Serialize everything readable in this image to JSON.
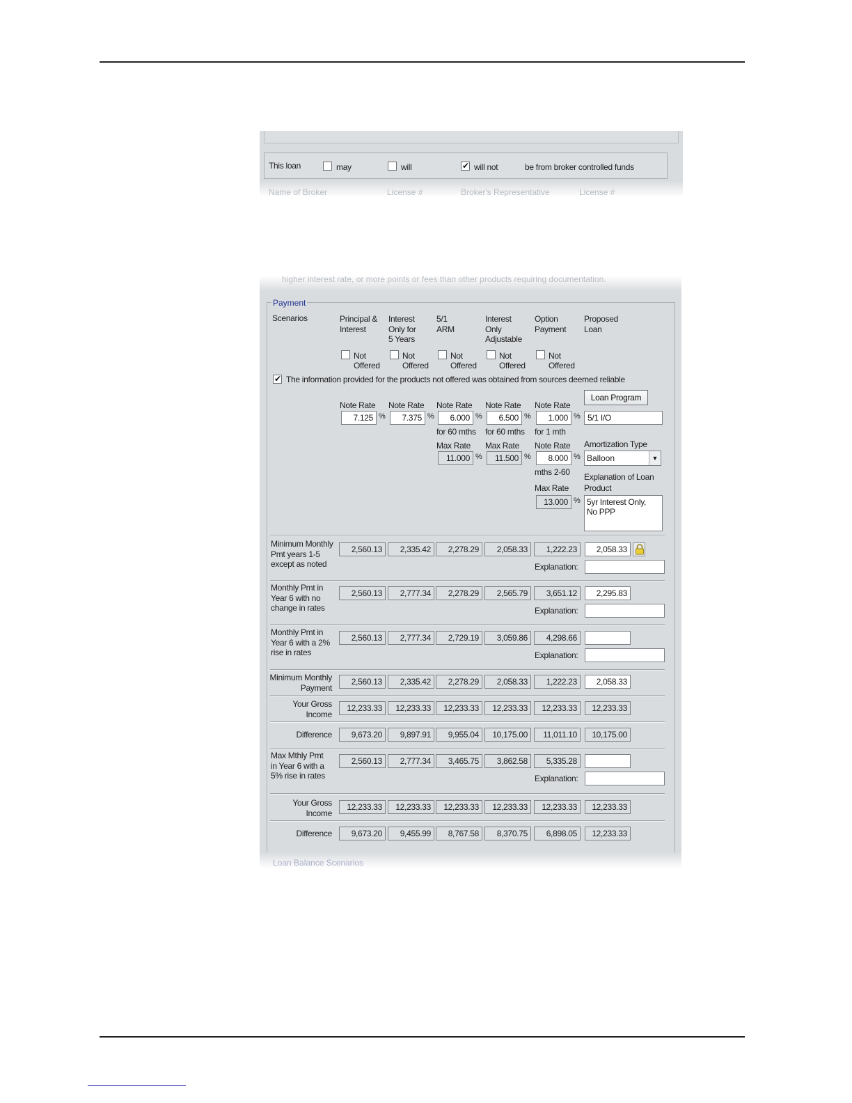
{
  "broker_funds": {
    "prefix": "This loan",
    "options": [
      {
        "label": "may",
        "checked": false
      },
      {
        "label": "will",
        "checked": false
      },
      {
        "label": "will not",
        "checked": true
      }
    ],
    "suffix": "be from broker controlled funds",
    "next_row_labels": [
      "Name of Broker",
      "License #",
      "Broker's Representative",
      "License #"
    ]
  },
  "cut_text": "higher interest rate, or more points or fees than other products requiring documentation.",
  "payment": {
    "group_title": "Payment",
    "scenarios_label": "Scenarios",
    "columns": [
      {
        "line1": "Principal &",
        "line2": "Interest",
        "line3": "",
        "not_offered": [
          "Not",
          "Offered"
        ]
      },
      {
        "line1": "Interest",
        "line2": "Only for",
        "line3": "5 Years",
        "not_offered": [
          "Not",
          "Offered"
        ]
      },
      {
        "line1": "5/1",
        "line2": "ARM",
        "line3": "",
        "not_offered": [
          "Not",
          "Offered"
        ]
      },
      {
        "line1": "Interest",
        "line2": "Only",
        "line3": "Adjustable",
        "not_offered": [
          "Not",
          "Offered"
        ]
      },
      {
        "line1": "Option",
        "line2": "Payment",
        "line3": "",
        "not_offered": [
          "Not",
          "Offered"
        ]
      },
      {
        "line1": "Proposed",
        "line2": "Loan",
        "line3": ""
      }
    ],
    "reliable_text": "The information provided for the products not offered was obtained from sources deemed reliable",
    "note_rate_label": "Note Rate",
    "note_rates": [
      "7.125",
      "7.375",
      "6.000",
      "6.500",
      "1.000"
    ],
    "percent": "%",
    "loan_program_button": "Loan Program",
    "loan_program_value": "5/1 I/O",
    "for_60_mths": "for 60 mths",
    "for_1_mth": "for 1 mth",
    "max_rate_label": "Max Rate",
    "max_rates": [
      "11.000",
      "11.500"
    ],
    "option_note_rate": "8.000",
    "mths_2_60": "mths 2-60",
    "option_max_rate": "13.000",
    "amortization_label": "Amortization Type",
    "amortization_value": "Balloon",
    "explanation_product_label": [
      "Explanation of Loan",
      "Product"
    ],
    "explanation_product_value": "5yr Interest Only,\nNo PPP",
    "explanation_label": "Explanation:",
    "rows": [
      {
        "label": [
          "Minimum Monthly",
          "Pmt years 1-5",
          "except as noted"
        ],
        "values": [
          "2,560.13",
          "2,335.42",
          "2,278.29",
          "2,058.33",
          "1,222.23"
        ],
        "proposed": "2,058.33"
      },
      {
        "label": [
          "Monthly Pmt in",
          "Year 6 with no",
          "change in rates"
        ],
        "values": [
          "2,560.13",
          "2,777.34",
          "2,278.29",
          "2,565.79",
          "3,651.12"
        ],
        "proposed": "2,295.83"
      },
      {
        "label": [
          "Monthly Pmt in",
          "Year 6 with a 2%",
          "rise in rates"
        ],
        "values": [
          "2,560.13",
          "2,777.34",
          "2,729.19",
          "3,059.86",
          "4,298.66"
        ],
        "proposed": ""
      },
      {
        "label": [
          "Minimum Monthly",
          "Payment"
        ],
        "values": [
          "2,560.13",
          "2,335.42",
          "2,278.29",
          "2,058.33",
          "1,222.23"
        ],
        "proposed": "2,058.33"
      },
      {
        "label": [
          "Your Gross",
          "Income"
        ],
        "values": [
          "12,233.33",
          "12,233.33",
          "12,233.33",
          "12,233.33",
          "12,233.33"
        ],
        "proposed": "12,233.33"
      },
      {
        "label": [
          "Difference"
        ],
        "values": [
          "9,673.20",
          "9,897.91",
          "9,955.04",
          "10,175.00",
          "11,011.10"
        ],
        "proposed": "10,175.00"
      },
      {
        "label": [
          "Max Mthly Pmt",
          "in Year 6 with a",
          "5% rise in rates"
        ],
        "values": [
          "2,560.13",
          "2,777.34",
          "3,465.75",
          "3,862.58",
          "5,335.28"
        ],
        "proposed": ""
      },
      {
        "label": [
          "Your Gross",
          "Income"
        ],
        "values": [
          "12,233.33",
          "12,233.33",
          "12,233.33",
          "12,233.33",
          "12,233.33"
        ],
        "proposed": "12,233.33"
      },
      {
        "label": [
          "Difference"
        ],
        "values": [
          "9,673.20",
          "9,455.99",
          "8,767.58",
          "8,370.75",
          "6,898.05"
        ],
        "proposed": "12,233.33"
      }
    ],
    "next_section": "Loan Balance Scenarios"
  }
}
